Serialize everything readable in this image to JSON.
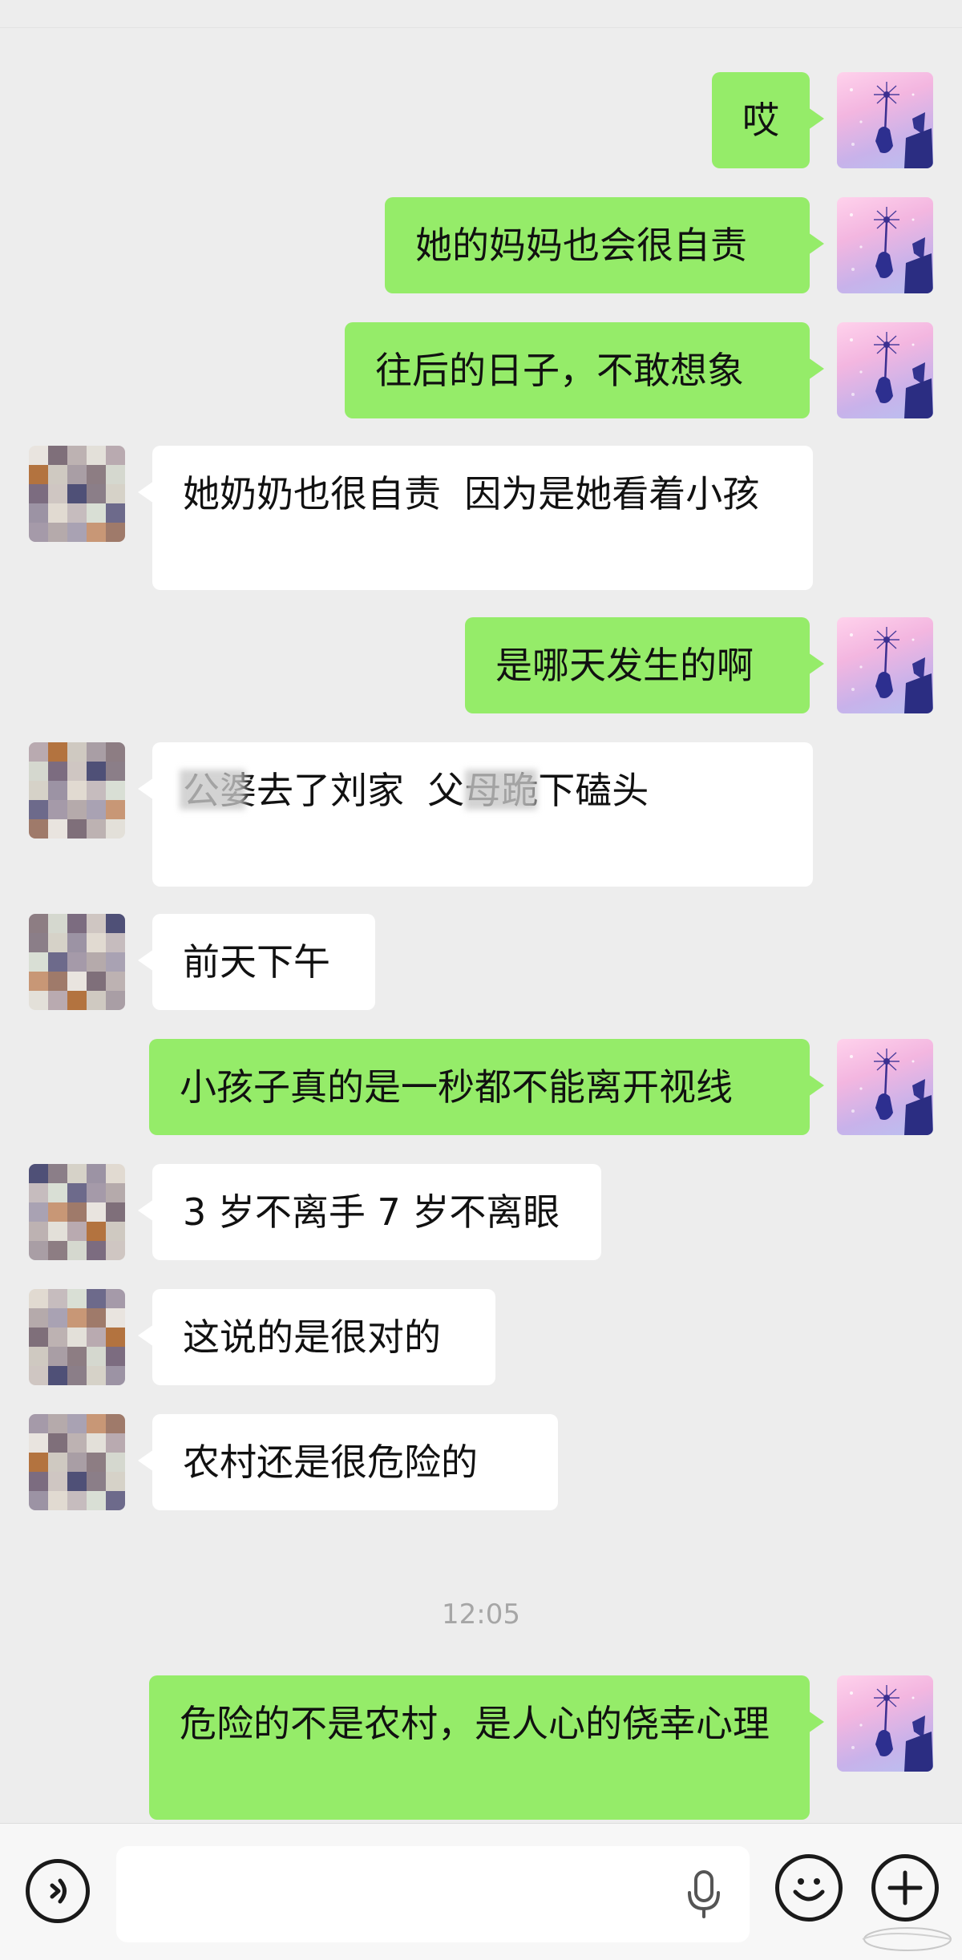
{
  "colors": {
    "background": "#ededed",
    "my_bubble": "#95ec69",
    "their_bubble": "#ffffff",
    "timestamp": "#a6a6a6"
  },
  "messages": [
    {
      "from": "me",
      "text": "哎"
    },
    {
      "from": "me",
      "text": "她的妈妈也会很自责"
    },
    {
      "from": "me",
      "text": "往后的日子，不敢想象"
    },
    {
      "from": "other",
      "text": "她奶奶也很自责  因为是她看着小孩"
    },
    {
      "from": "me",
      "text": "是哪天发生的啊"
    },
    {
      "from": "other",
      "text": "公婆去了刘家  父母跪下磕头"
    },
    {
      "from": "other",
      "text": "前天下午"
    },
    {
      "from": "me",
      "text": "小孩子真的是一秒都不能离开视线"
    },
    {
      "from": "other",
      "text": "3 岁不离手 7 岁不离眼"
    },
    {
      "from": "other",
      "text": "这说的是很对的"
    },
    {
      "from": "other",
      "text": "农村还是很危险的"
    },
    {
      "from": "me",
      "text": "危险的不是农村，是人心的侥幸心理"
    }
  ],
  "timestamp": "12:05",
  "input": {
    "value": "",
    "voice_icon": "voice-icon",
    "mic_icon": "mic-icon",
    "emoji_icon": "emoji-icon",
    "plus_icon": "plus-icon"
  }
}
